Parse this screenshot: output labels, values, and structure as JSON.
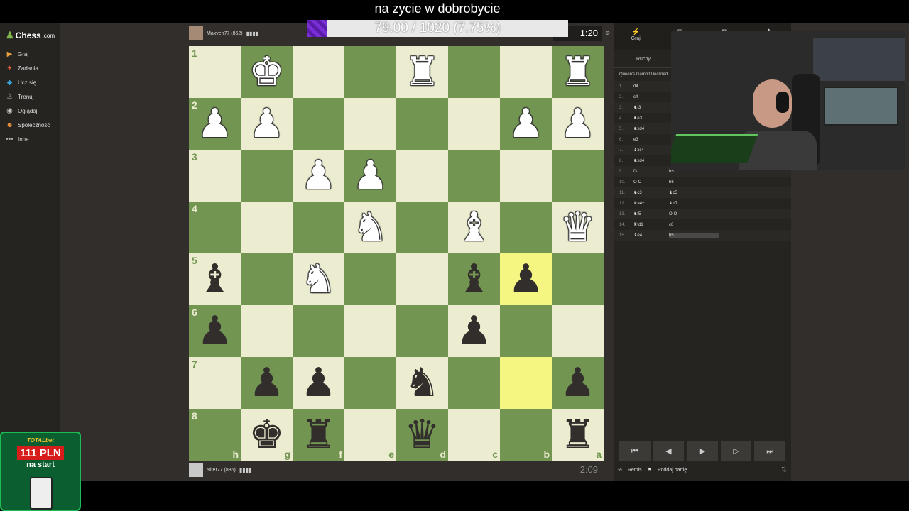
{
  "overlay": {
    "title": "na zycie w dobrobycie",
    "goal_text": "79.00 / 1020 (7.75%)",
    "goal_progress_percent": 7.75
  },
  "sidebar": {
    "logo": "Chess",
    "logo_suffix": ".com",
    "items": [
      {
        "label": "Graj",
        "icon": "play-icon",
        "glyph": "▶",
        "color": "#e89f3c"
      },
      {
        "label": "Zadania",
        "icon": "puzzle-icon",
        "glyph": "✦",
        "color": "#e0623a"
      },
      {
        "label": "Ucz się",
        "icon": "learn-icon",
        "glyph": "◆",
        "color": "#3aa0d8"
      },
      {
        "label": "Trenuj",
        "icon": "train-icon",
        "glyph": "♙",
        "color": "#9f9f9f"
      },
      {
        "label": "Oglądaj",
        "icon": "watch-icon",
        "glyph": "◉",
        "color": "#c8c8c8"
      },
      {
        "label": "Społeczność",
        "icon": "community-icon",
        "glyph": "☻",
        "color": "#e08a3a"
      },
      {
        "label": "Inne",
        "icon": "more-icon",
        "glyph": "•••",
        "color": "#aaaaaa"
      }
    ]
  },
  "top_player": {
    "name": "Maxven77 (852)",
    "flags": "▮▮▮▮",
    "clock": "1:20"
  },
  "bottom_player": {
    "name": "Niter77 (836)",
    "flags": "▮▮▮▮",
    "clock": "2:09"
  },
  "board": {
    "ranks": [
      "1",
      "2",
      "3",
      "4",
      "5",
      "6",
      "7",
      "8"
    ],
    "files": [
      "h",
      "g",
      "f",
      "e",
      "d",
      "c",
      "b",
      "a"
    ],
    "highlights": [
      [
        4,
        6
      ],
      [
        6,
        6
      ]
    ],
    "pieces": [
      {
        "row": 0,
        "col": 1,
        "glyph": "♚",
        "color": "w",
        "name": "white-king"
      },
      {
        "row": 0,
        "col": 4,
        "glyph": "♜",
        "color": "w",
        "name": "white-rook"
      },
      {
        "row": 0,
        "col": 7,
        "glyph": "♜",
        "color": "w",
        "name": "white-rook"
      },
      {
        "row": 1,
        "col": 0,
        "glyph": "♟",
        "color": "w",
        "name": "white-pawn"
      },
      {
        "row": 1,
        "col": 1,
        "glyph": "♟",
        "color": "w",
        "name": "white-pawn"
      },
      {
        "row": 1,
        "col": 6,
        "glyph": "♟",
        "color": "w",
        "name": "white-pawn"
      },
      {
        "row": 1,
        "col": 7,
        "glyph": "♟",
        "color": "w",
        "name": "white-pawn"
      },
      {
        "row": 2,
        "col": 2,
        "glyph": "♟",
        "color": "w",
        "name": "white-pawn"
      },
      {
        "row": 2,
        "col": 3,
        "glyph": "♟",
        "color": "w",
        "name": "white-pawn"
      },
      {
        "row": 3,
        "col": 3,
        "glyph": "♞",
        "color": "w",
        "name": "white-knight"
      },
      {
        "row": 3,
        "col": 5,
        "glyph": "♝",
        "color": "w",
        "name": "white-bishop"
      },
      {
        "row": 3,
        "col": 7,
        "glyph": "♛",
        "color": "w",
        "name": "white-queen"
      },
      {
        "row": 4,
        "col": 0,
        "glyph": "♝",
        "color": "b",
        "name": "black-bishop"
      },
      {
        "row": 4,
        "col": 2,
        "glyph": "♞",
        "color": "w",
        "name": "white-knight"
      },
      {
        "row": 4,
        "col": 5,
        "glyph": "♝",
        "color": "b",
        "name": "black-bishop"
      },
      {
        "row": 4,
        "col": 6,
        "glyph": "♟",
        "color": "b",
        "name": "black-pawn"
      },
      {
        "row": 5,
        "col": 0,
        "glyph": "♟",
        "color": "b",
        "name": "black-pawn"
      },
      {
        "row": 5,
        "col": 5,
        "glyph": "♟",
        "color": "b",
        "name": "black-pawn"
      },
      {
        "row": 6,
        "col": 1,
        "glyph": "♟",
        "color": "b",
        "name": "black-pawn"
      },
      {
        "row": 6,
        "col": 2,
        "glyph": "♟",
        "color": "b",
        "name": "black-pawn"
      },
      {
        "row": 6,
        "col": 4,
        "glyph": "♞",
        "color": "b",
        "name": "black-knight"
      },
      {
        "row": 6,
        "col": 7,
        "glyph": "♟",
        "color": "b",
        "name": "black-pawn"
      },
      {
        "row": 7,
        "col": 1,
        "glyph": "♚",
        "color": "b",
        "name": "black-king"
      },
      {
        "row": 7,
        "col": 2,
        "glyph": "♜",
        "color": "b",
        "name": "black-rook"
      },
      {
        "row": 7,
        "col": 4,
        "glyph": "♛",
        "color": "b",
        "name": "black-queen"
      },
      {
        "row": 7,
        "col": 7,
        "glyph": "♜",
        "color": "b",
        "name": "black-rook"
      }
    ]
  },
  "panel": {
    "tabs": [
      {
        "label": "Graj",
        "icon": "bolt-icon",
        "glyph": "⚡"
      },
      {
        "label": "",
        "icon": "new-game-icon",
        "glyph": "⊞"
      },
      {
        "label": "",
        "icon": "games-icon",
        "glyph": "⊠"
      },
      {
        "label": "",
        "icon": "players-icon",
        "glyph": "♟"
      }
    ],
    "subtab": "Ruchy",
    "opening": "Queen's Gambit Declined",
    "moves": [
      {
        "n": "1.",
        "w": "d4",
        "b": ""
      },
      {
        "n": "2.",
        "w": "c4",
        "b": ""
      },
      {
        "n": "3.",
        "w": "♞f3",
        "b": ""
      },
      {
        "n": "4.",
        "w": "♞e3",
        "b": ""
      },
      {
        "n": "5.",
        "w": "♞xd4",
        "b": ""
      },
      {
        "n": "6.",
        "w": "e3",
        "b": ""
      },
      {
        "n": "7.",
        "w": "♝xc4",
        "b": ""
      },
      {
        "n": "8.",
        "w": "♞xd4",
        "b": ""
      },
      {
        "n": "9.",
        "w": "f3",
        "b": "h5"
      },
      {
        "n": "10.",
        "w": "O-O",
        "b": "h6"
      },
      {
        "n": "11.",
        "w": "♞c3",
        "b": "♝c5"
      },
      {
        "n": "12.",
        "w": "♛a4+",
        "b": "♝d7"
      },
      {
        "n": "13.",
        "w": "♞f5",
        "b": "O-O"
      },
      {
        "n": "14.",
        "w": "♜fd1",
        "b": "c6"
      },
      {
        "n": "15.",
        "w": "♝e4",
        "b": "b5"
      }
    ],
    "draw_label": "Remis",
    "resign_label": "Poddaj partię",
    "draw_prefix": "½"
  },
  "ad": {
    "brand": "TOTAL",
    "brand_suffix": "bet",
    "amount": "111 PLN",
    "subtitle": "na start"
  }
}
